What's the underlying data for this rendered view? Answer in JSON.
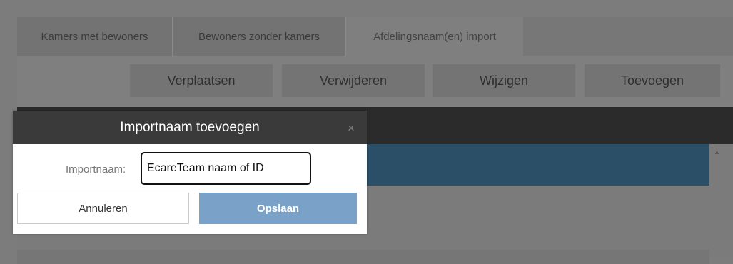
{
  "tabs": [
    {
      "label": "Kamers met bewoners"
    },
    {
      "label": "Bewoners zonder kamers"
    },
    {
      "label": "Afdelingsnaam(en) import"
    }
  ],
  "toolbar": {
    "move_label": "Verplaatsen",
    "delete_label": "Verwijderen",
    "edit_label": "Wijzigen",
    "add_label": "Toevoegen"
  },
  "modal": {
    "title": "Importnaam toevoegen",
    "close_glyph": "×",
    "field_label": "Importnaam:",
    "field_value": "EcareTeam naam of ID",
    "cancel_label": "Annuleren",
    "save_label": "Opslaan"
  },
  "scroll": {
    "up_glyph": "▲"
  },
  "colors": {
    "modal_header": "#3a3a3a",
    "save_button": "#7aa1c7",
    "selected_row": "#2c4f68"
  }
}
